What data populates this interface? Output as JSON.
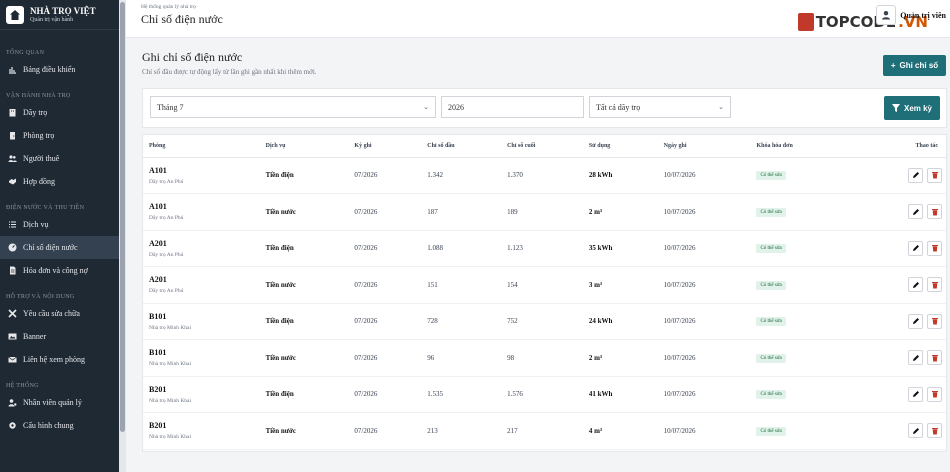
{
  "brand": {
    "name": "NHÀ TRỌ VIỆT",
    "tagline": "Quản trị vận hành"
  },
  "sidebar": {
    "sections": [
      {
        "title": "TỔNG QUAN",
        "items": [
          {
            "label": "Bảng điều khiển",
            "icon": "chart-icon",
            "active": false
          }
        ]
      },
      {
        "title": "VẬN HÀNH NHÀ TRỌ",
        "items": [
          {
            "label": "Dãy trọ",
            "icon": "building-icon",
            "active": false
          },
          {
            "label": "Phòng trọ",
            "icon": "door-icon",
            "active": false
          },
          {
            "label": "Người thuê",
            "icon": "users-icon",
            "active": false
          },
          {
            "label": "Hợp đồng",
            "icon": "contract-icon",
            "active": false
          }
        ]
      },
      {
        "title": "ĐIỆN NƯỚC VÀ THU TIỀN",
        "items": [
          {
            "label": "Dịch vụ",
            "icon": "list-icon",
            "active": false
          },
          {
            "label": "Chỉ số điện nước",
            "icon": "gauge-icon",
            "active": true
          },
          {
            "label": "Hóa đơn và công nợ",
            "icon": "invoice-icon",
            "active": false
          }
        ]
      },
      {
        "title": "HỖ TRỢ VÀ NỘI DUNG",
        "items": [
          {
            "label": "Yêu cầu sửa chữa",
            "icon": "tools-icon",
            "active": false
          },
          {
            "label": "Banner",
            "icon": "image-icon",
            "active": false
          },
          {
            "label": "Liên hệ xem phòng",
            "icon": "mail-icon",
            "active": false
          }
        ]
      },
      {
        "title": "HỆ THỐNG",
        "items": [
          {
            "label": "Nhân viên quản lý",
            "icon": "user-gear-icon",
            "active": false
          },
          {
            "label": "Cấu hình chung",
            "icon": "gear-icon",
            "active": false
          }
        ]
      }
    ]
  },
  "header": {
    "breadcrumb": "Hệ thống quản lý nhà trọ",
    "title": "Chỉ số điện nước",
    "user": "Quản trị viên",
    "watermark": {
      "main": "TOPCODE",
      "dot": ".VN"
    }
  },
  "main": {
    "heading": "Ghi chỉ số điện nước",
    "subtitle": "Chỉ số đầu được tự động lấy từ lần ghi gần nhất khi thêm mới.",
    "add_button": "Ghi chỉ số",
    "filters": {
      "month": "Tháng 7",
      "year": "2026",
      "building": "Tất cả dãy trọ",
      "view_button": "Xem kỳ"
    },
    "columns": [
      "Phòng",
      "Dịch vụ",
      "Kỳ ghi",
      "Chỉ số đầu",
      "Chỉ số cuối",
      "Sử dụng",
      "Ngày ghi",
      "Khóa hóa đơn",
      "Thao tác"
    ],
    "rows": [
      {
        "room": "A101",
        "place": "Dãy trọ An Phú",
        "service": "Tiền điện",
        "period": "07/2026",
        "start": "1.342",
        "end": "1.370",
        "usage": "28 kWh",
        "date": "10/07/2026",
        "lock": "Có thể sửa"
      },
      {
        "room": "A101",
        "place": "Dãy trọ An Phú",
        "service": "Tiền nước",
        "period": "07/2026",
        "start": "187",
        "end": "189",
        "usage": "2 m³",
        "date": "10/07/2026",
        "lock": "Có thể sửa"
      },
      {
        "room": "A201",
        "place": "Dãy trọ An Phú",
        "service": "Tiền điện",
        "period": "07/2026",
        "start": "1.088",
        "end": "1.123",
        "usage": "35 kWh",
        "date": "10/07/2026",
        "lock": "Có thể sửa"
      },
      {
        "room": "A201",
        "place": "Dãy trọ An Phú",
        "service": "Tiền nước",
        "period": "07/2026",
        "start": "151",
        "end": "154",
        "usage": "3 m³",
        "date": "10/07/2026",
        "lock": "Có thể sửa"
      },
      {
        "room": "B101",
        "place": "Nhà trọ Minh Khai",
        "service": "Tiền điện",
        "period": "07/2026",
        "start": "728",
        "end": "752",
        "usage": "24 kWh",
        "date": "10/07/2026",
        "lock": "Có thể sửa"
      },
      {
        "room": "B101",
        "place": "Nhà trọ Minh Khai",
        "service": "Tiền nước",
        "period": "07/2026",
        "start": "96",
        "end": "98",
        "usage": "2 m³",
        "date": "10/07/2026",
        "lock": "Có thể sửa"
      },
      {
        "room": "B201",
        "place": "Nhà trọ Minh Khai",
        "service": "Tiền điện",
        "period": "07/2026",
        "start": "1.535",
        "end": "1.576",
        "usage": "41 kWh",
        "date": "10/07/2026",
        "lock": "Có thể sửa"
      },
      {
        "room": "B201",
        "place": "Nhà trọ Minh Khai",
        "service": "Tiền nước",
        "period": "07/2026",
        "start": "213",
        "end": "217",
        "usage": "4 m³",
        "date": "10/07/2026",
        "lock": "Có thể sửa"
      }
    ]
  },
  "colors": {
    "sidebar": "#1f2933",
    "accent": "#1f6f78",
    "delete": "#c0392b",
    "badge": "#e0f2e9"
  }
}
